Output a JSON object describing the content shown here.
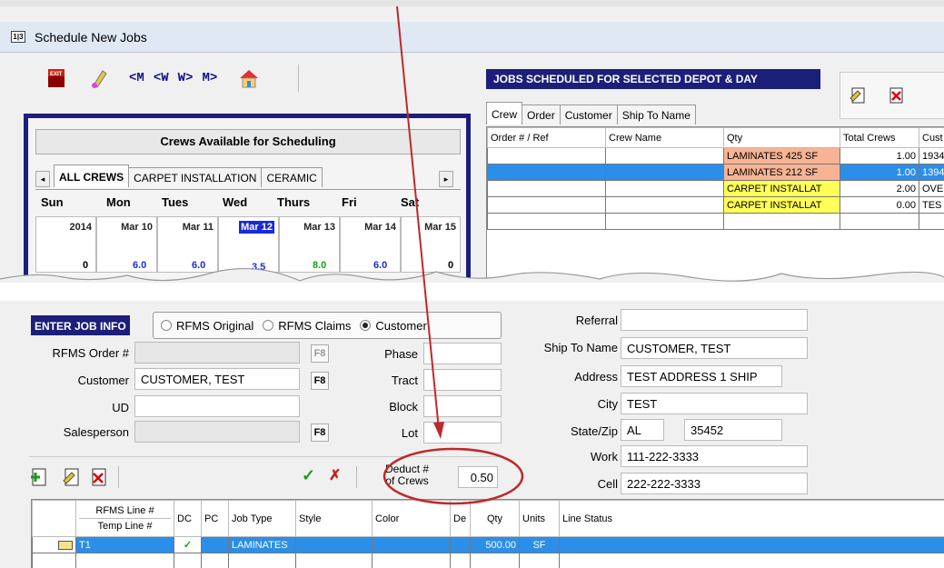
{
  "window": {
    "title": "Schedule New Jobs",
    "icon_text": "1|3"
  },
  "toolbar": {
    "exit_label": "EXIT",
    "nav": [
      "<M",
      "<W",
      "W>",
      "M>"
    ]
  },
  "crews_panel": {
    "title": "Crews Available for Scheduling",
    "tabs": [
      "ALL CREWS",
      "CARPET INSTALLATION",
      "CERAMIC"
    ],
    "days": [
      "Sun",
      "Mon",
      "Tues",
      "Wed",
      "Thurs",
      "Fri",
      "Sat"
    ],
    "dates": [
      "2014",
      "Mar 10",
      "Mar 11",
      "Mar 12",
      "Mar 13",
      "Mar 14",
      "Mar 15"
    ],
    "values": [
      "0",
      "6.0",
      "6.0",
      "3.5",
      "8.0",
      "6.0",
      "0"
    ],
    "selected_index": 3
  },
  "jobs_panel": {
    "title": "JOBS SCHEDULED FOR SELECTED DEPOT & DAY",
    "tabs": [
      "Crew",
      "Order",
      "Customer",
      "Ship To Name"
    ],
    "columns": [
      "Order # / Ref",
      "Crew Name",
      "Qty",
      "Total Crews",
      "Cust"
    ],
    "rows": [
      {
        "order": "",
        "crew": "",
        "qty": "LAMINATES 425 SF",
        "crews": "1.00",
        "cust": "1934"
      },
      {
        "order": "",
        "crew": "",
        "qty": "LAMINATES 212 SF",
        "crews": "1.00",
        "cust": "1394"
      },
      {
        "order": "",
        "crew": "",
        "qty": "CARPET INSTALLAT",
        "crews": "2.00",
        "cust": "OVE"
      },
      {
        "order": "",
        "crew": "",
        "qty": "CARPET INSTALLAT",
        "crews": "0.00",
        "cust": "TES"
      }
    ]
  },
  "job_info": {
    "header": "ENTER JOB INFO",
    "radios": [
      "RFMS Original",
      "RFMS Claims",
      "Customer"
    ],
    "selected_radio": 2,
    "labels": {
      "rfms_order": "RFMS Order #",
      "customer": "Customer",
      "ud": "UD",
      "salesperson": "Salesperson",
      "phase": "Phase",
      "tract": "Tract",
      "block": "Block",
      "lot": "Lot",
      "referral": "Referral",
      "ship_to": "Ship To Name",
      "address": "Address",
      "city": "City",
      "state_zip": "State/Zip",
      "work": "Work",
      "cell": "Cell"
    },
    "values": {
      "rfms_order": "",
      "customer": "CUSTOMER, TEST",
      "ud": "",
      "salesperson": "",
      "phase": "",
      "tract": "",
      "block": "",
      "lot": "",
      "referral": "",
      "ship_to": "CUSTOMER, TEST",
      "address": "TEST ADDRESS 1 SHIP",
      "city": "TEST",
      "state": "AL",
      "zip": "35452",
      "work": "111-222-3333",
      "cell": "222-222-3333"
    },
    "f8": "F8",
    "deduct_label_1": "Deduct #",
    "deduct_label_2": "of Crews",
    "deduct_value": "0.50"
  },
  "lines_grid": {
    "columns": [
      "RFMS Line #",
      "Temp Line #",
      "DC",
      "PC",
      "Job Type",
      "Style",
      "Color",
      "De",
      "Qty",
      "Units",
      "Line Status"
    ],
    "row": {
      "line": "T1",
      "dc": "✓",
      "pc": "",
      "job_type": "LAMINATES",
      "style": "",
      "color": "",
      "de": "",
      "qty": "500.00",
      "units": "SF",
      "status": ""
    }
  },
  "colors": {
    "panel_border": "#1b1f7a",
    "laminates": "#f7b393",
    "carpet": "#ffff55",
    "selection": "#2b8ee8",
    "annotation": "#c0282a"
  }
}
